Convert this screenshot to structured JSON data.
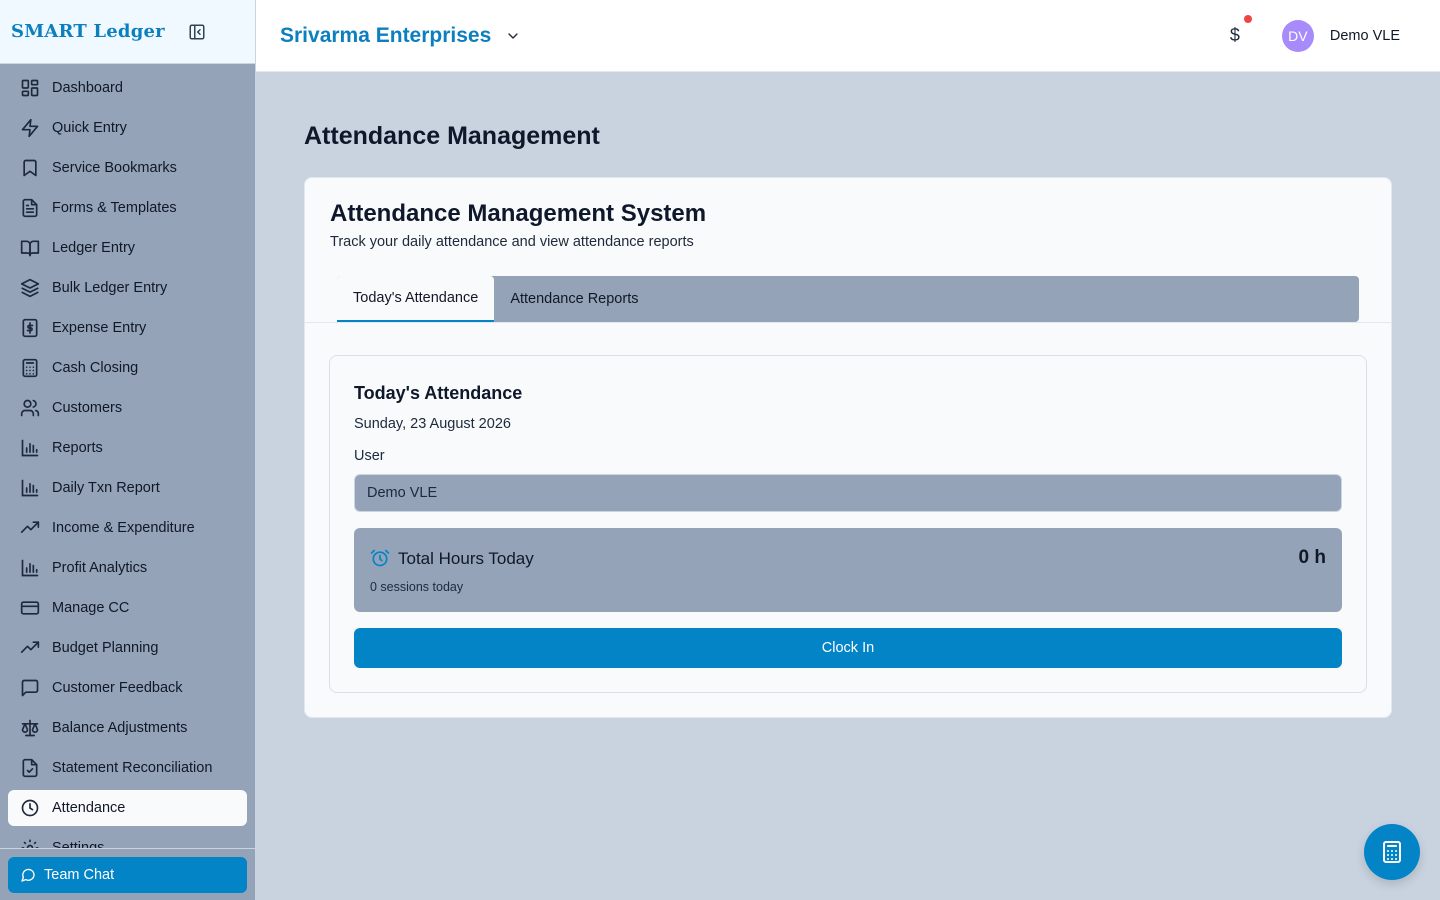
{
  "brand": {
    "name": "SMART Ledger"
  },
  "sidebar": {
    "items": [
      {
        "label": "Dashboard",
        "icon": "dashboard-icon"
      },
      {
        "label": "Quick Entry",
        "icon": "lightning-icon"
      },
      {
        "label": "Service Bookmarks",
        "icon": "bookmark-icon"
      },
      {
        "label": "Forms & Templates",
        "icon": "file-text-icon"
      },
      {
        "label": "Ledger Entry",
        "icon": "book-open-icon"
      },
      {
        "label": "Bulk Ledger Entry",
        "icon": "layers-icon"
      },
      {
        "label": "Expense Entry",
        "icon": "receipt-dollar-icon"
      },
      {
        "label": "Cash Closing",
        "icon": "calculator-icon"
      },
      {
        "label": "Customers",
        "icon": "users-icon"
      },
      {
        "label": "Reports",
        "icon": "bar-chart-icon"
      },
      {
        "label": "Daily Txn Report",
        "icon": "bar-chart-icon"
      },
      {
        "label": "Income & Expenditure",
        "icon": "trending-up-icon"
      },
      {
        "label": "Profit Analytics",
        "icon": "bar-chart-icon"
      },
      {
        "label": "Manage CC",
        "icon": "credit-card-icon"
      },
      {
        "label": "Budget Planning",
        "icon": "trending-up-icon"
      },
      {
        "label": "Customer Feedback",
        "icon": "message-square-icon"
      },
      {
        "label": "Balance Adjustments",
        "icon": "scale-icon"
      },
      {
        "label": "Statement Reconciliation",
        "icon": "file-check-icon"
      },
      {
        "label": "Attendance",
        "icon": "clock-icon",
        "active": true
      },
      {
        "label": "Settings",
        "icon": "gear-icon"
      }
    ],
    "team_chat_label": "Team Chat"
  },
  "header": {
    "org_name": "Srivarma Enterprises",
    "currency_symbol": "$",
    "avatar_initials": "DV",
    "user_name": "Demo VLE"
  },
  "main": {
    "page_title": "Attendance Management",
    "card_title": "Attendance Management System",
    "card_subtitle": "Track your daily attendance and view attendance reports",
    "tabs": [
      {
        "label": "Today's Attendance",
        "active": true
      },
      {
        "label": "Attendance Reports",
        "active": false
      }
    ],
    "today": {
      "title": "Today's Attendance",
      "date": "Sunday, 23 August 2026",
      "user_label": "User",
      "user_value": "Demo VLE",
      "hours_label": "Total Hours Today",
      "hours_value": "0 h",
      "sessions_text": "0 sessions today",
      "clock_in_label": "Clock In"
    }
  },
  "colors": {
    "accent": "#0284c7",
    "brand": "#0c7fbf",
    "sidebar_bg": "#94a3b8",
    "page_bg": "#c9d3df",
    "notification_dot": "#ef4444",
    "avatar_bg": "#a78bfa"
  }
}
